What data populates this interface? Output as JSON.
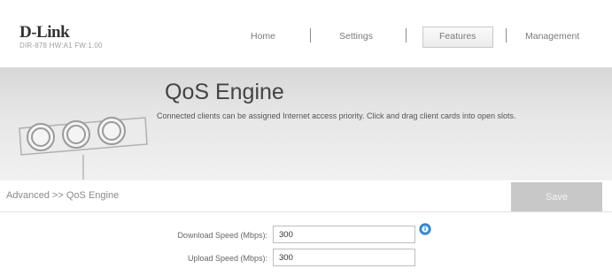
{
  "brand": {
    "logo": "D-Link",
    "model": "DIR-878 HW:A1 FW:1.00"
  },
  "nav": {
    "items": [
      "Home",
      "Settings",
      "Features",
      "Management"
    ],
    "active": "Features"
  },
  "banner": {
    "title": "QoS Engine",
    "description": "Connected clients can be assigned Internet access priority. Click and drag client cards into open slots."
  },
  "breadcrumb": {
    "text": "Advanced >> QoS Engine"
  },
  "toolbar": {
    "save_label": "Save"
  },
  "form": {
    "download_label": "Download Speed (Mbps):",
    "download_value": "300",
    "upload_label": "Upload Speed (Mbps):",
    "upload_value": "300"
  },
  "colors": {
    "banner": "#e3e3e3",
    "save_button": "#c8c8c8",
    "info_icon": "#3a8fd6"
  },
  "icons": {
    "info": "info-icon",
    "banner": "qos-knobs-illustration"
  }
}
